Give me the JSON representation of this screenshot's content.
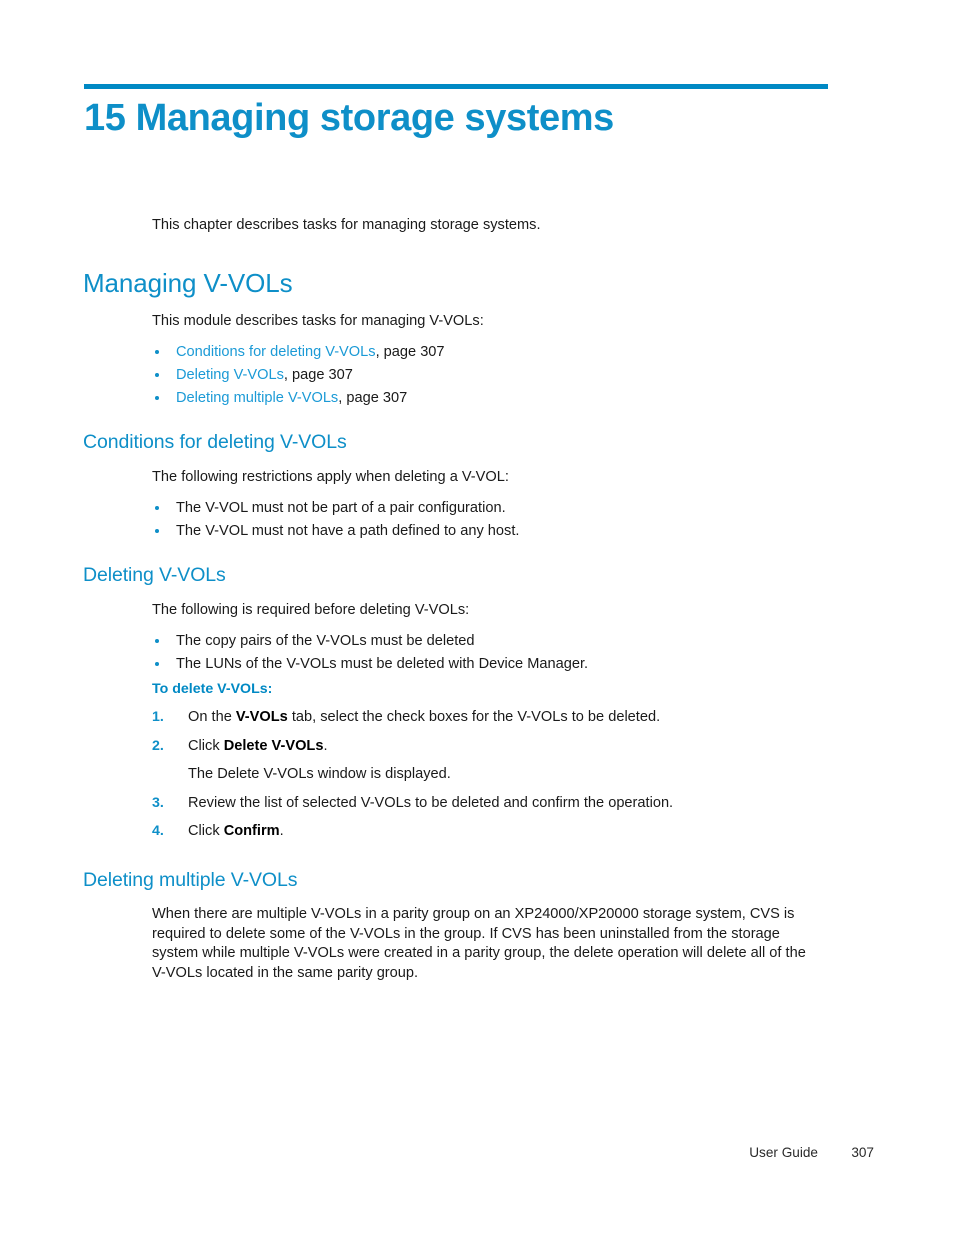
{
  "page": {
    "footer_label": "User Guide",
    "footer_page": "307"
  },
  "chapter": {
    "title": "15 Managing storage systems",
    "intro": "This chapter describes tasks for managing storage systems."
  },
  "sections": {
    "managing_vvols": {
      "heading": "Managing V-VOLs",
      "intro": "This module describes tasks for managing V-VOLs:",
      "links": [
        {
          "text": "Conditions for deleting V-VOLs",
          "suffix": ", page 307"
        },
        {
          "text": "Deleting V-VOLs",
          "suffix": ", page 307"
        },
        {
          "text": "Deleting multiple V-VOLs",
          "suffix": ", page 307"
        }
      ]
    },
    "conditions": {
      "heading": "Conditions for deleting V-VOLs",
      "intro": "The following restrictions apply when deleting a V-VOL:",
      "bullets": [
        "The V-VOL must not be part of a pair configuration.",
        "The V-VOL must not have a path defined to any host."
      ]
    },
    "deleting": {
      "heading": "Deleting V-VOLs",
      "intro": "The following is required before deleting V-VOLs:",
      "bullets": [
        "The copy pairs of the V-VOLs must be deleted",
        "The LUNs of the V-VOLs must be deleted with Device Manager."
      ],
      "procedure_heading": "To delete V-VOLs:",
      "steps": [
        {
          "num": "1.",
          "pre": "On the ",
          "bold": "V-VOLs",
          "post": " tab, select the check boxes for the V-VOLs to be deleted."
        },
        {
          "num": "2.",
          "pre": "Click ",
          "bold": "Delete V-VOLs",
          "post": "."
        },
        {
          "num": "3.",
          "pre": "Review the list of selected V-VOLs to be deleted and confirm the operation.",
          "bold": "",
          "post": ""
        },
        {
          "num": "4.",
          "pre": "Click ",
          "bold": "Confirm",
          "post": "."
        }
      ],
      "step2_result": "The Delete V-VOLs window is displayed."
    },
    "deleting_multiple": {
      "heading": "Deleting multiple V-VOLs",
      "paragraph": "When there are multiple V-VOLs in a parity group on an XP24000/XP20000 storage system, CVS is required to delete some of the V-VOLs in the group. If CVS has been uninstalled from the storage system while multiple V-VOLs were created in a parity group, the delete operation will delete all of the V-VOLs located in the same parity group."
    }
  },
  "colors": {
    "accent_blue": "#0E8FC8",
    "rule_blue": "#0089C4",
    "link_blue": "#1B9AD6"
  }
}
